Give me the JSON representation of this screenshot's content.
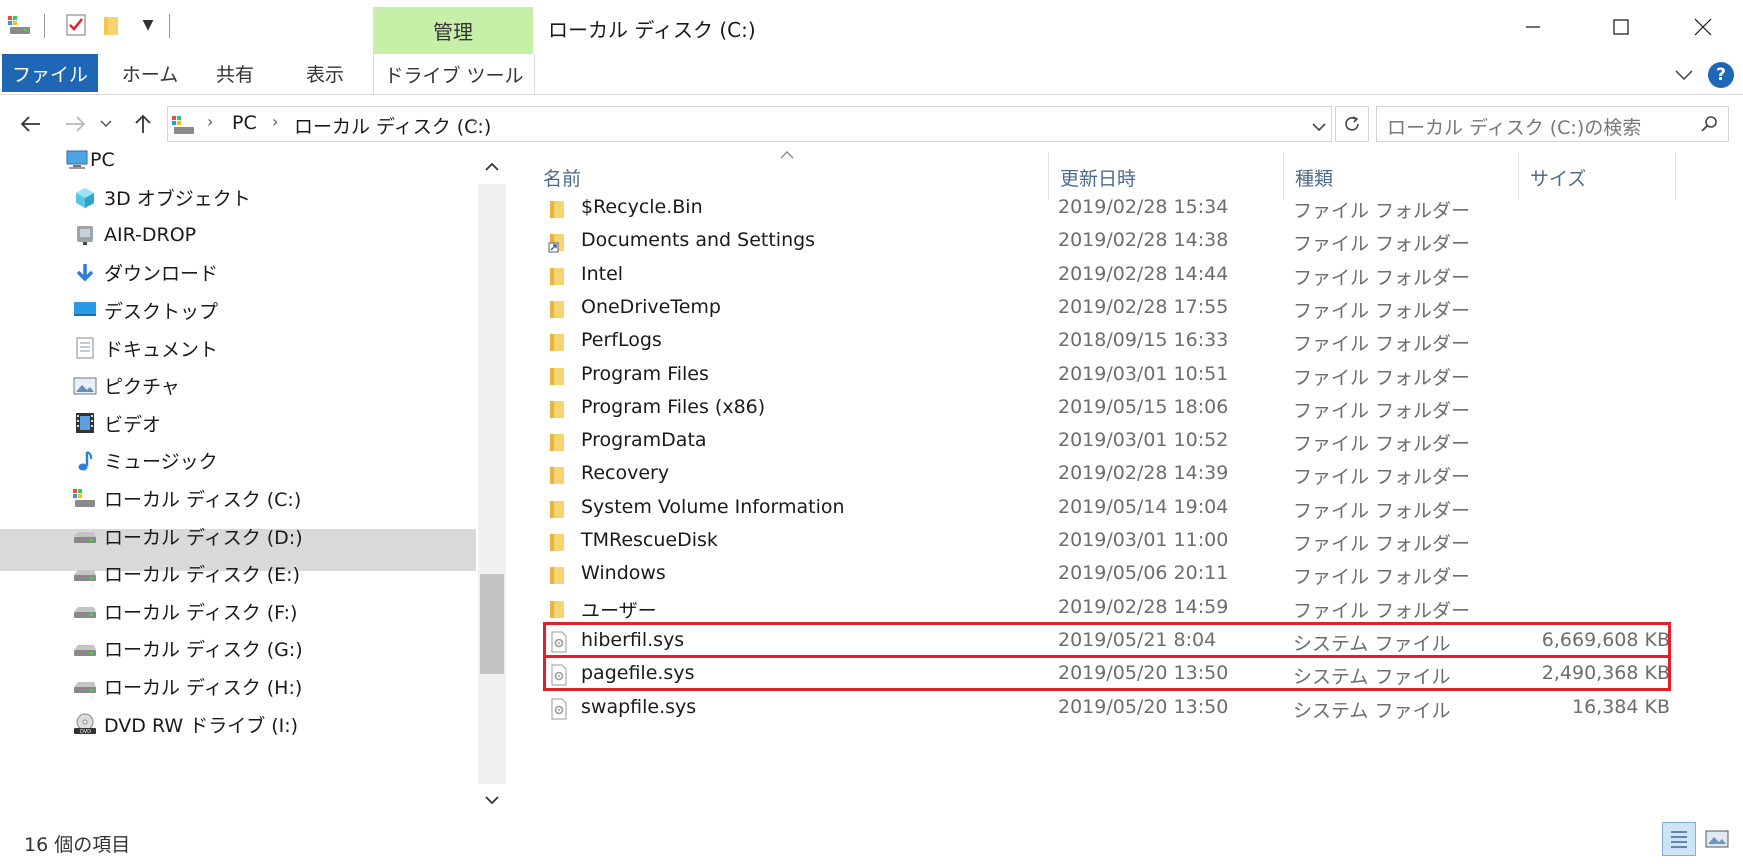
{
  "window": {
    "title": "ローカル ディスク (C:)"
  },
  "ribbon": {
    "contextual_group": "管理",
    "tabs": [
      {
        "label": "ファイル"
      },
      {
        "label": "ホーム"
      },
      {
        "label": "共有"
      },
      {
        "label": "表示"
      },
      {
        "label": "ドライブ ツール"
      }
    ]
  },
  "address": {
    "crumbs": [
      "PC",
      "ローカル ディスク (C:)"
    ],
    "search_placeholder": "ローカル ディスク (C:)の検索"
  },
  "nav": {
    "items": [
      {
        "label": "PC",
        "icon": "pc-icon"
      },
      {
        "label": "3D オブジェクト",
        "icon": "3d-objects-icon"
      },
      {
        "label": "AIR-DROP",
        "icon": "network-drive-icon"
      },
      {
        "label": "ダウンロード",
        "icon": "download-icon"
      },
      {
        "label": "デスクトップ",
        "icon": "desktop-icon"
      },
      {
        "label": "ドキュメント",
        "icon": "documents-icon"
      },
      {
        "label": "ピクチャ",
        "icon": "pictures-icon"
      },
      {
        "label": "ビデオ",
        "icon": "video-icon"
      },
      {
        "label": "ミュージック",
        "icon": "music-icon"
      },
      {
        "label": "ローカル ディスク (C:)",
        "icon": "system-drive-icon",
        "selected": true
      },
      {
        "label": "ローカル ディスク (D:)",
        "icon": "drive-icon"
      },
      {
        "label": "ローカル ディスク (E:)",
        "icon": "drive-icon"
      },
      {
        "label": "ローカル ディスク (F:)",
        "icon": "drive-icon"
      },
      {
        "label": "ローカル ディスク (G:)",
        "icon": "drive-icon"
      },
      {
        "label": "ローカル ディスク (H:)",
        "icon": "drive-icon"
      },
      {
        "label": "DVD RW ドライブ (I:)",
        "icon": "dvd-drive-icon"
      }
    ]
  },
  "list": {
    "columns": [
      "名前",
      "更新日時",
      "種類",
      "サイズ"
    ],
    "rows": [
      {
        "name": "$Recycle.Bin",
        "date": "2019/02/28 15:34",
        "type": "ファイル フォルダー",
        "size": "",
        "icon": "folder-icon"
      },
      {
        "name": "Documents and Settings",
        "date": "2019/02/28 14:38",
        "type": "ファイル フォルダー",
        "size": "",
        "icon": "folder-shortcut-icon"
      },
      {
        "name": "Intel",
        "date": "2019/02/28 14:44",
        "type": "ファイル フォルダー",
        "size": "",
        "icon": "folder-icon"
      },
      {
        "name": "OneDriveTemp",
        "date": "2019/02/28 17:55",
        "type": "ファイル フォルダー",
        "size": "",
        "icon": "folder-icon"
      },
      {
        "name": "PerfLogs",
        "date": "2018/09/15 16:33",
        "type": "ファイル フォルダー",
        "size": "",
        "icon": "folder-icon"
      },
      {
        "name": "Program Files",
        "date": "2019/03/01 10:51",
        "type": "ファイル フォルダー",
        "size": "",
        "icon": "folder-icon"
      },
      {
        "name": "Program Files (x86)",
        "date": "2019/05/15 18:06",
        "type": "ファイル フォルダー",
        "size": "",
        "icon": "folder-icon"
      },
      {
        "name": "ProgramData",
        "date": "2019/03/01 10:52",
        "type": "ファイル フォルダー",
        "size": "",
        "icon": "folder-icon"
      },
      {
        "name": "Recovery",
        "date": "2019/02/28 14:39",
        "type": "ファイル フォルダー",
        "size": "",
        "icon": "folder-icon"
      },
      {
        "name": "System Volume Information",
        "date": "2019/05/14 19:04",
        "type": "ファイル フォルダー",
        "size": "",
        "icon": "folder-icon"
      },
      {
        "name": "TMRescueDisk",
        "date": "2019/03/01 11:00",
        "type": "ファイル フォルダー",
        "size": "",
        "icon": "folder-icon"
      },
      {
        "name": "Windows",
        "date": "2019/05/06 20:11",
        "type": "ファイル フォルダー",
        "size": "",
        "icon": "folder-icon"
      },
      {
        "name": "ユーザー",
        "date": "2019/02/28 14:59",
        "type": "ファイル フォルダー",
        "size": "",
        "icon": "folder-icon"
      },
      {
        "name": "hiberfil.sys",
        "date": "2019/05/21 8:04",
        "type": "システム ファイル",
        "size": "6,669,608 KB",
        "icon": "system-file-icon",
        "highlighted": true
      },
      {
        "name": "pagefile.sys",
        "date": "2019/05/20 13:50",
        "type": "システム ファイル",
        "size": "2,490,368 KB",
        "icon": "system-file-icon",
        "highlighted": true
      },
      {
        "name": "swapfile.sys",
        "date": "2019/05/20 13:50",
        "type": "システム ファイル",
        "size": "16,384 KB",
        "icon": "system-file-icon"
      }
    ]
  },
  "status": {
    "item_count": "16 個の項目"
  },
  "colors": {
    "file_tab": "#1e67b5",
    "manage_tab": "#c6efa8",
    "highlight": "#e0202a",
    "folder": "#f4c64a"
  }
}
